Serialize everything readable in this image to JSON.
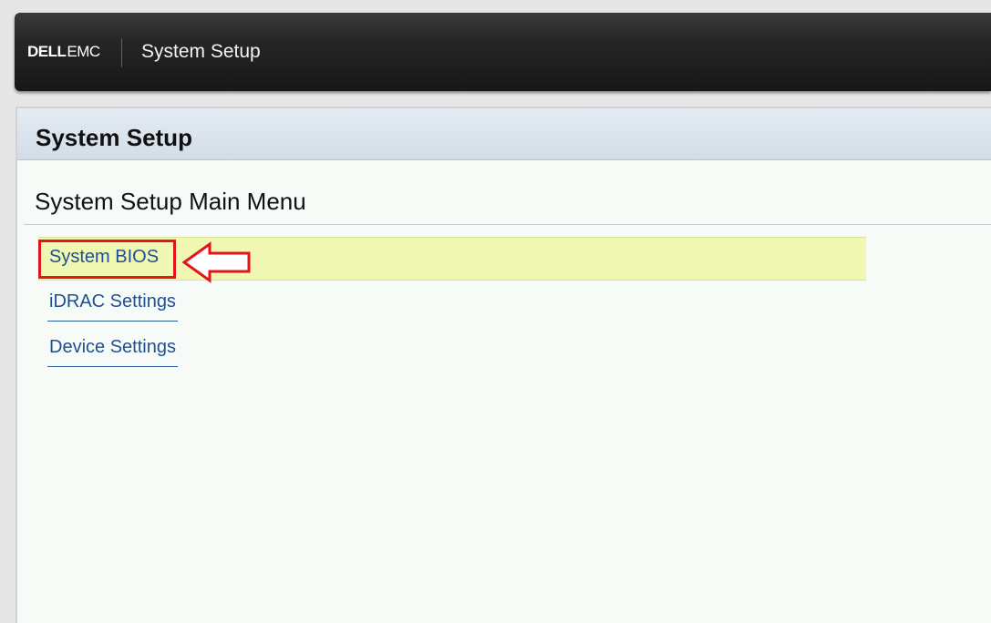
{
  "header": {
    "brand_dell": "DELL",
    "brand_emc": "EMC",
    "app_title": "System Setup"
  },
  "panel": {
    "title": "System Setup",
    "menu_heading": "System Setup Main Menu"
  },
  "menu": {
    "items": [
      {
        "label": "System BIOS"
      },
      {
        "label": "iDRAC Settings"
      },
      {
        "label": "Device Settings"
      }
    ],
    "selected_index": 0
  },
  "annotation": {
    "highlight_color": "#e3141b",
    "arrow_icon": "left-arrow-outline-icon"
  },
  "colors": {
    "topbar": "#1c1c1c",
    "panel_header": "#d9e2eb",
    "panel_bg": "#f7fbf7",
    "selected_row": "#f0f7b3",
    "link": "#1f4f92"
  }
}
